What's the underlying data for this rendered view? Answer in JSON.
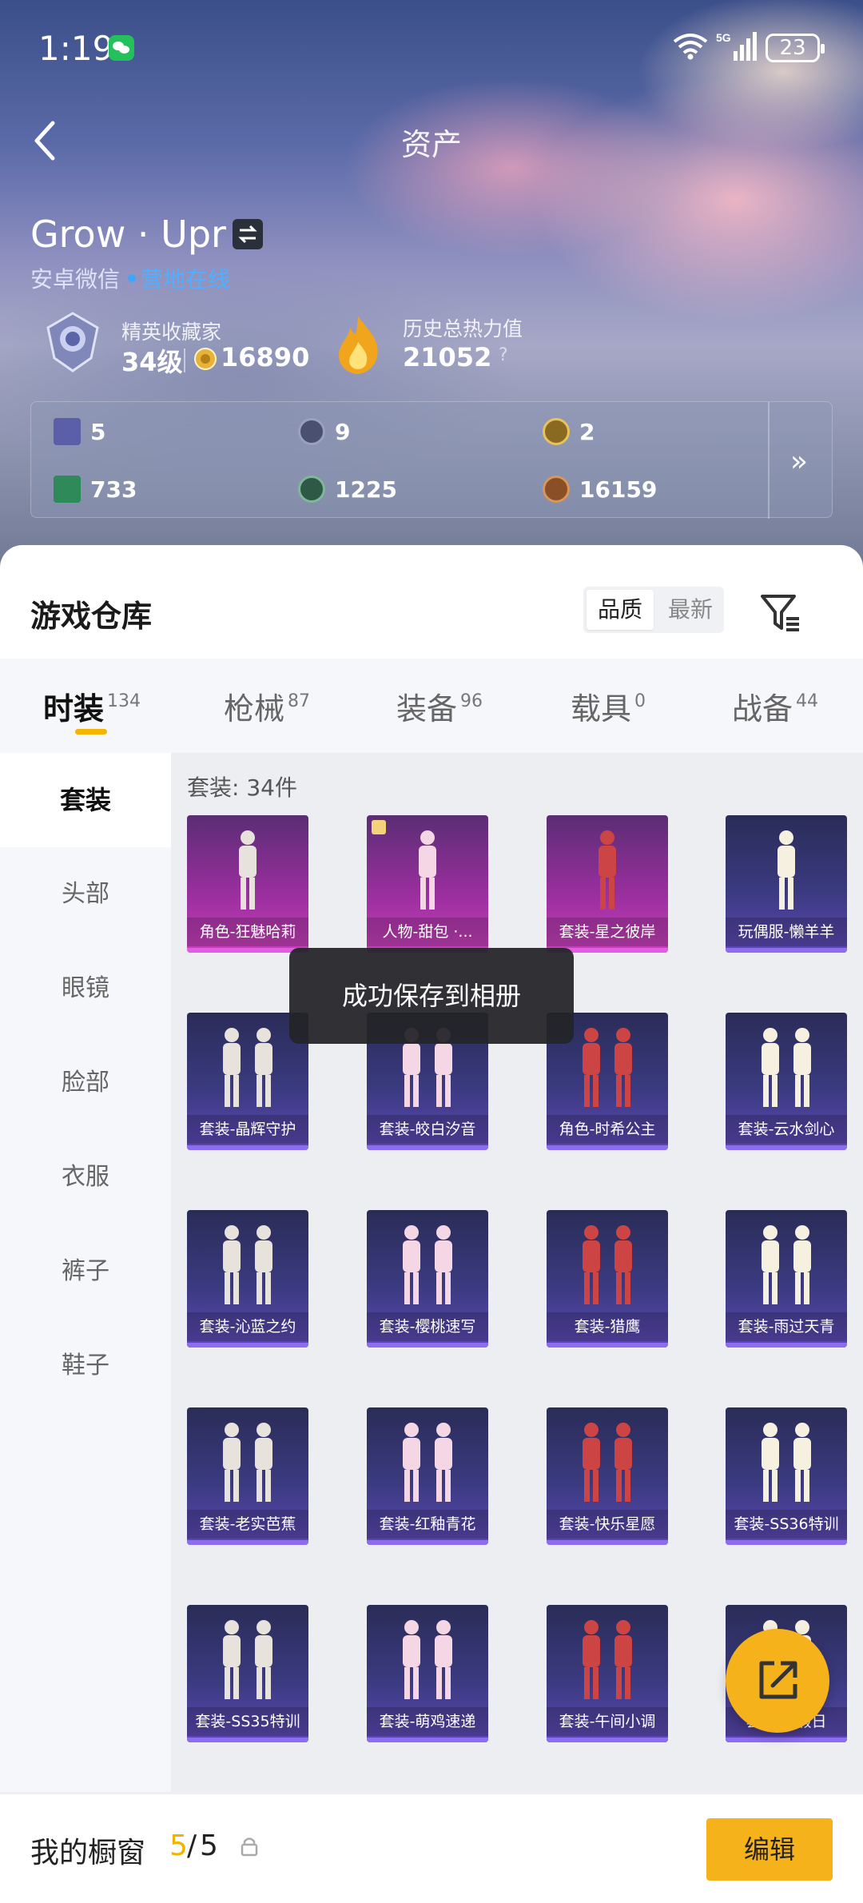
{
  "status_bar": {
    "time": "1:19",
    "network": "5G",
    "battery": "23"
  },
  "nav": {
    "title": "资产"
  },
  "user": {
    "name": "Grow · Upr",
    "platform": "安卓微信",
    "online_status": "营地在线"
  },
  "stats": {
    "collector_label": "精英收藏家",
    "collector_level": "34级",
    "collector_points": "16890",
    "heat_label": "历史总热力值",
    "heat_value": "21052",
    "help": "?"
  },
  "currencies": [
    {
      "value": "5",
      "icon": "card-icon",
      "color": "#5a5fa8"
    },
    {
      "value": "9",
      "icon": "silver-coin-icon",
      "color": "#4a5070"
    },
    {
      "value": "2",
      "icon": "gold-coin-icon",
      "color": "#8a6a20"
    },
    {
      "value": "733",
      "icon": "green-ticket-icon",
      "color": "#2f8a5a"
    },
    {
      "value": "1225",
      "icon": "green-orb-icon",
      "color": "#2e5a45"
    },
    {
      "value": "16159",
      "icon": "bronze-coin-icon",
      "color": "#8a4f26"
    }
  ],
  "warehouse": {
    "title": "游戏仓库",
    "sort_options": [
      "品质",
      "最新"
    ],
    "active_sort": "品质"
  },
  "tabs": [
    {
      "label": "时装",
      "count": "134"
    },
    {
      "label": "枪械",
      "count": "87"
    },
    {
      "label": "装备",
      "count": "96"
    },
    {
      "label": "载具",
      "count": "0"
    },
    {
      "label": "战备",
      "count": "44"
    }
  ],
  "sidebar": [
    "套装",
    "头部",
    "眼镜",
    "脸部",
    "衣服",
    "裤子",
    "鞋子"
  ],
  "grid": {
    "count_label": "套装: 34件",
    "items": [
      {
        "label": "角色-狂魅哈莉",
        "rarity": "purple"
      },
      {
        "label": "人物-甜包 ·...",
        "rarity": "purple"
      },
      {
        "label": "套装-星之彼岸",
        "rarity": "purple"
      },
      {
        "label": "玩偶服-懒羊羊",
        "rarity": "blue"
      },
      {
        "label": "套装-晶辉守护",
        "rarity": "blue"
      },
      {
        "label": "套装-皎白汐音",
        "rarity": "blue"
      },
      {
        "label": "角色-时希公主",
        "rarity": "blue"
      },
      {
        "label": "套装-云水剑心",
        "rarity": "blue"
      },
      {
        "label": "套装-沁蓝之约",
        "rarity": "blue"
      },
      {
        "label": "套装-樱桃速写",
        "rarity": "blue"
      },
      {
        "label": "套装-猎鹰",
        "rarity": "blue"
      },
      {
        "label": "套装-雨过天青",
        "rarity": "blue"
      },
      {
        "label": "套装-老实芭蕉",
        "rarity": "blue"
      },
      {
        "label": "套装-红釉青花",
        "rarity": "blue"
      },
      {
        "label": "套装-快乐星愿",
        "rarity": "blue"
      },
      {
        "label": "套装-SS36特训",
        "rarity": "blue"
      },
      {
        "label": "套装-SS35特训",
        "rarity": "blue"
      },
      {
        "label": "套装-萌鸡速递",
        "rarity": "blue"
      },
      {
        "label": "套装-午间小调",
        "rarity": "blue"
      },
      {
        "label": "套装-...假日",
        "rarity": "blue"
      }
    ]
  },
  "toast": "成功保存到相册",
  "showcase": {
    "label": "我的橱窗",
    "count": "5",
    "total": "5"
  },
  "edit_button": "编辑"
}
